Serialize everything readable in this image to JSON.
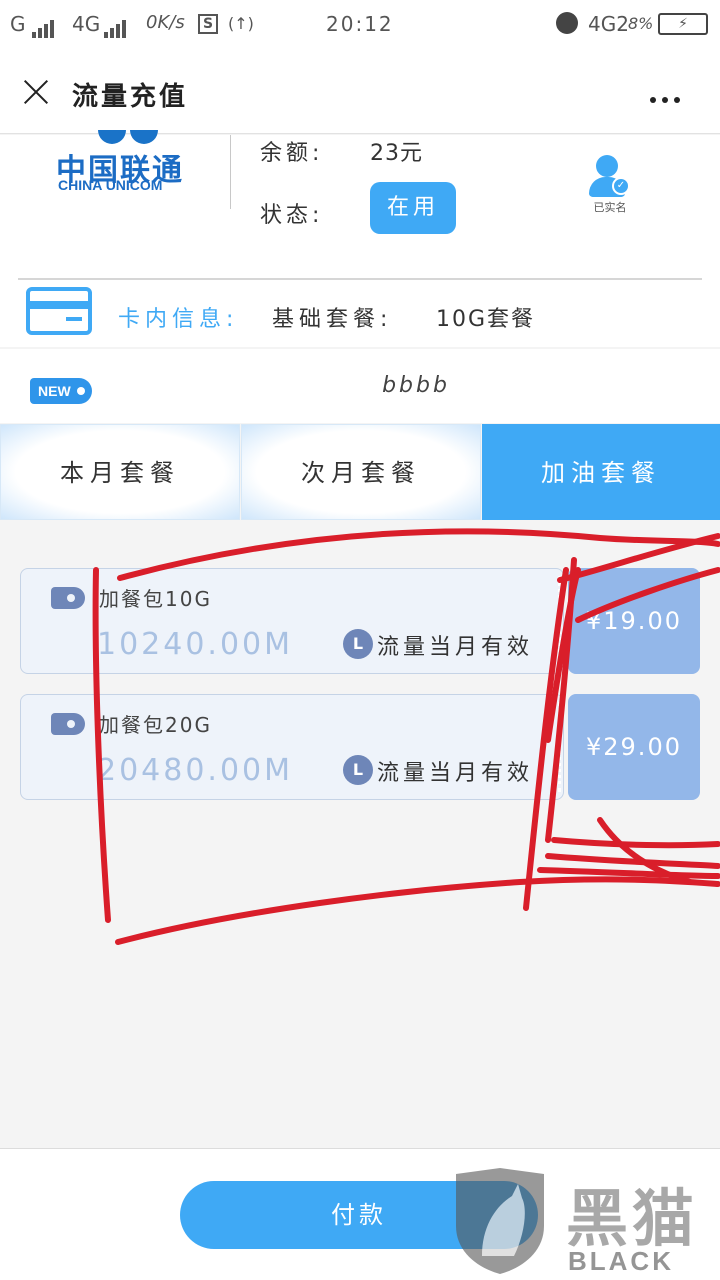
{
  "status_bar": {
    "carrier1": "G",
    "carrier2": "4G",
    "speed": "0K/s",
    "sim_icon_text": "S",
    "wifi_text": "(↑)",
    "time": "20:12",
    "network": "4G2",
    "battery_percent": "8%",
    "battery_icon": "⚡"
  },
  "header": {
    "title": "流量充值",
    "close_icon": "close-icon",
    "more_icon": "more-icon"
  },
  "account": {
    "logo_cn": "中国联通",
    "logo_en": "CHINA UNICOM",
    "balance_label": "余额:",
    "balance_value": "23元",
    "status_label": "状态:",
    "status_value": "在用",
    "verified_label": "已实名",
    "card_info_label": "卡内信息:",
    "base_plan_label": "基础套餐:",
    "base_plan_value": "10G套餐"
  },
  "notice": {
    "badge": "NEW",
    "text": "bbbb"
  },
  "tabs": [
    {
      "label": "本月套餐",
      "active": false
    },
    {
      "label": "次月套餐",
      "active": false
    },
    {
      "label": "加油套餐",
      "active": true
    }
  ],
  "packages": [
    {
      "name": "加餐包10G",
      "amount": "10240.00M",
      "validity": "流量当月有效",
      "price": "¥19.00"
    },
    {
      "name": "加餐包20G",
      "amount": "20480.00M",
      "validity": "流量当月有效",
      "price": "¥29.00"
    }
  ],
  "clock_glyph": "L",
  "pay_button": "付款",
  "watermark": {
    "cn": "黑猫",
    "en": "BLACK CAT"
  },
  "colors": {
    "accent": "#3fa9f5",
    "price_bg": "#93b7e9",
    "package_bg": "#eef3fa",
    "scribble": "#d91e2a"
  }
}
